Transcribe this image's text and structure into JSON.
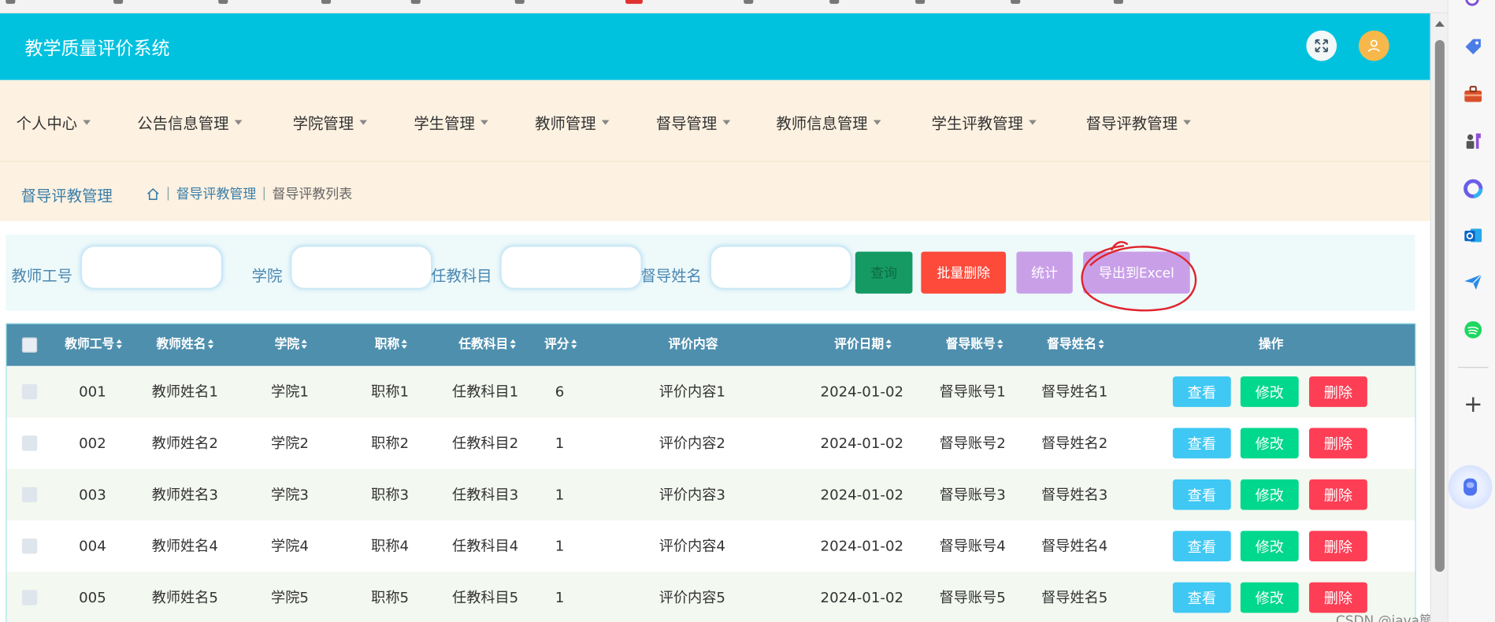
{
  "header": {
    "title": "教学质量评价系统"
  },
  "nav": {
    "items": [
      "个人中心",
      "公告信息管理",
      "学院管理",
      "学生管理",
      "教师管理",
      "督导管理",
      "教师信息管理",
      "学生评教管理",
      "督导评教管理"
    ]
  },
  "breadcrumb": {
    "title": "督导评教管理",
    "items": [
      "督导评教管理",
      "督导评教列表"
    ]
  },
  "search": {
    "labels": [
      "教师工号",
      "学院",
      "任教科目",
      "督导姓名"
    ],
    "buttons": {
      "query": "查询",
      "batch_delete": "批量删除",
      "stats": "统计",
      "export": "导出到Excel"
    }
  },
  "table": {
    "columns": [
      "教师工号",
      "教师姓名",
      "学院",
      "职称",
      "任教科目",
      "评分",
      "评价内容",
      "评价日期",
      "督导账号",
      "督导姓名",
      "操作"
    ],
    "actions": {
      "view": "查看",
      "edit": "修改",
      "delete": "删除"
    },
    "rows": [
      [
        "001",
        "教师姓名1",
        "学院1",
        "职称1",
        "任教科目1",
        "6",
        "评价内容1",
        "2024-01-02",
        "督导账号1",
        "督导姓名1"
      ],
      [
        "002",
        "教师姓名2",
        "学院2",
        "职称2",
        "任教科目2",
        "1",
        "评价内容2",
        "2024-01-02",
        "督导账号2",
        "督导姓名2"
      ],
      [
        "003",
        "教师姓名3",
        "学院3",
        "职称3",
        "任教科目3",
        "1",
        "评价内容3",
        "2024-01-02",
        "督导账号3",
        "督导姓名3"
      ],
      [
        "004",
        "教师姓名4",
        "学院4",
        "职称4",
        "任教科目4",
        "1",
        "评价内容4",
        "2024-01-02",
        "督导账号4",
        "督导姓名4"
      ],
      [
        "005",
        "教师姓名5",
        "学院5",
        "职称5",
        "任教科目5",
        "1",
        "评价内容5",
        "2024-01-02",
        "督导账号5",
        "督导姓名5"
      ]
    ]
  },
  "watermark": "CSDN @java簡單遗忘",
  "colors": {
    "header": "#00c2df",
    "nav_bg": "#fdf1e1",
    "table_head": "#4e8fae",
    "view": "#3fc8f4",
    "edit": "#00d88d",
    "delete": "#fd3e55",
    "query": "#159a64",
    "batch_delete": "#fd4a3a",
    "stats": "#c9a0e8",
    "export": "#c9a0e8"
  }
}
